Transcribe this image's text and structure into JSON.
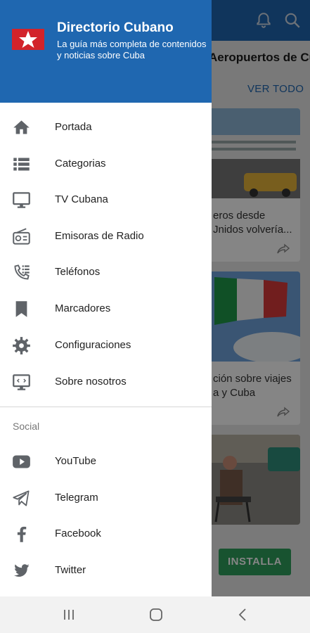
{
  "colors": {
    "brand_blue": "#1f67b0",
    "install_green": "#2e9f5d",
    "icon_gray": "#5f6368"
  },
  "drawer": {
    "title": "Directorio Cubano",
    "subtitle": "La guía más completa de contenidos y noticias sobre Cuba",
    "menu": [
      {
        "label": "Portada",
        "icon": "home-icon"
      },
      {
        "label": "Categorias",
        "icon": "list-icon"
      },
      {
        "label": "TV Cubana",
        "icon": "monitor-icon"
      },
      {
        "label": "Emisoras de Radio",
        "icon": "radio-icon"
      },
      {
        "label": "Teléfonos",
        "icon": "phone-list-icon"
      },
      {
        "label": "Marcadores",
        "icon": "bookmark-icon"
      },
      {
        "label": "Configuraciones",
        "icon": "gear-icon"
      },
      {
        "label": "Sobre nosotros",
        "icon": "code-monitor-icon"
      }
    ],
    "social_heading": "Social",
    "social": [
      {
        "label": "YouTube",
        "icon": "youtube-icon"
      },
      {
        "label": "Telegram",
        "icon": "telegram-icon"
      },
      {
        "label": "Facebook",
        "icon": "facebook-icon"
      },
      {
        "label": "Twitter",
        "icon": "twitter-icon"
      }
    ]
  },
  "background": {
    "section_title": "Aeropuertos de Cub",
    "view_all": "VER TODO",
    "cards": [
      {
        "text_line1": "eros desde",
        "text_line2": "Jnidos volvería..."
      },
      {
        "text_line1": "ción sobre viajes",
        "text_line2": "a y Cuba"
      }
    ],
    "install_button": "INSTALLA"
  }
}
